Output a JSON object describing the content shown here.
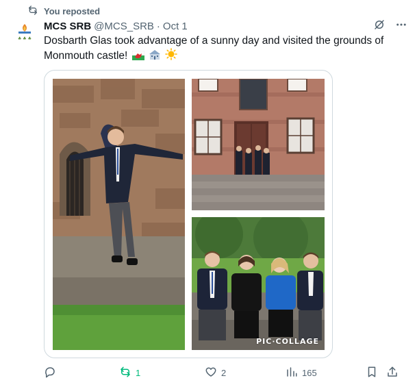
{
  "repost_banner": {
    "text": "You reposted"
  },
  "tweet": {
    "display_name": "MCS SRB",
    "handle": "@MCS_SRB",
    "separator": "·",
    "date": "Oct 1",
    "text": "Dosbarth Glas took advantage of a sunny day and visited the grounds of Monmouth castle!",
    "emojis": [
      "welsh-flag",
      "school-building",
      "sun"
    ]
  },
  "media": {
    "photos": [
      "boy-jumping-from-castle-wall",
      "group-on-steps-of-castle-building",
      "four-students-sitting-on-bench"
    ],
    "watermark": "PIC·COLLAGE"
  },
  "actions": {
    "reply_count": "",
    "repost_count": "1",
    "like_count": "2",
    "view_count": "165"
  },
  "colors": {
    "repost_active": "#00ba7c",
    "muted": "#536471",
    "border": "#cfd9de"
  }
}
